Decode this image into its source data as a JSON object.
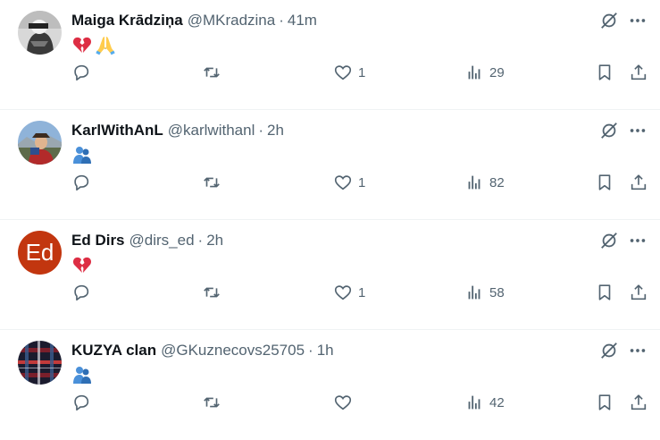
{
  "tweets": [
    {
      "name": "Maiga Krādziņa",
      "handle": "@MKradzina",
      "time": "41m",
      "emoji": [
        "broken-heart",
        "folded-hands"
      ],
      "likes": "1",
      "views": "29",
      "avatar": "photo-bw",
      "avatar_letter": ""
    },
    {
      "name": "KarlWithAnL",
      "handle": "@karlwithanl",
      "time": "2h",
      "emoji": [
        "people-hugging"
      ],
      "likes": "1",
      "views": "82",
      "avatar": "photo-outdoor",
      "avatar_letter": ""
    },
    {
      "name": "Ed Dirs",
      "handle": "@dirs_ed",
      "time": "2h",
      "emoji": [
        "broken-heart"
      ],
      "likes": "1",
      "views": "58",
      "avatar": "letter",
      "avatar_letter": "Ed"
    },
    {
      "name": "KUZYA clan",
      "handle": "@GKuznecovs25705",
      "time": "1h",
      "emoji": [
        "people-hugging"
      ],
      "likes": "",
      "views": "42",
      "avatar": "plaid",
      "avatar_letter": ""
    }
  ],
  "separator": "·",
  "colors": {
    "text": "#0f1419",
    "muted": "#536471",
    "border": "#eff3f4",
    "avatar_letter_bg": "#c2360f",
    "broken_heart": "#e0245e",
    "hands": "#f4b400",
    "hug": "#4a90d9"
  }
}
